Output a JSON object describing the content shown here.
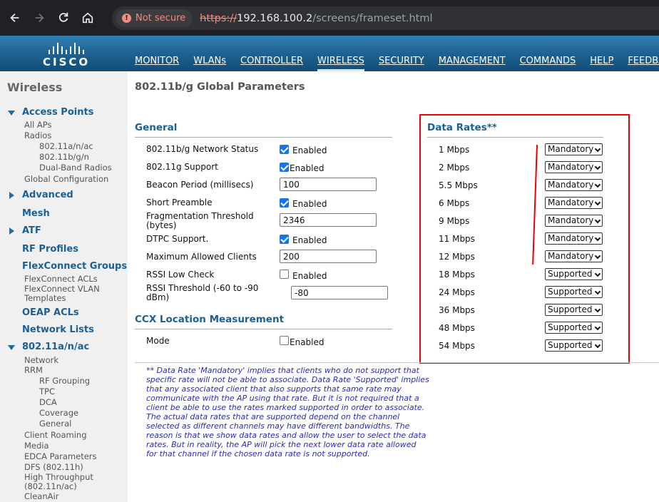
{
  "browser": {
    "security_label": "Not secure",
    "url_scheme": "https://",
    "url_host": "192.168.100.2",
    "url_path": "/screens/frameset.html"
  },
  "brand": {
    "logo_text": "CISCO"
  },
  "menu": [
    "MONITOR",
    "WLANs",
    "CONTROLLER",
    "WIRELESS",
    "SECURITY",
    "MANAGEMENT",
    "COMMANDS",
    "HELP",
    "FEEDBACK"
  ],
  "menu_active": "WIRELESS",
  "sidebar": {
    "title": "Wireless",
    "access_points": "Access Points",
    "all_aps": "All APs",
    "radios": "Radios",
    "radio_a": "802.11a/n/ac",
    "radio_b": "802.11b/g/n",
    "radio_dual": "Dual-Band Radios",
    "global_config": "Global Configuration",
    "advanced": "Advanced",
    "mesh": "Mesh",
    "atf": "ATF",
    "rf_profiles": "RF Profiles",
    "flexconnect_groups": "FlexConnect Groups",
    "flexconnect_acls": "FlexConnect ACLs",
    "flexconnect_vlan_1": "FlexConnect VLAN",
    "flexconnect_vlan_2": "Templates",
    "oeap_acls": "OEAP ACLs",
    "network_lists": "Network Lists",
    "band_a": "802.11a/n/ac",
    "network": "Network",
    "rrm": "RRM",
    "rf_grouping": "RF Grouping",
    "tpc": "TPC",
    "dca": "DCA",
    "coverage": "Coverage",
    "general": "General",
    "client_roaming": "Client Roaming",
    "media": "Media",
    "edca": "EDCA Parameters",
    "dfs": "DFS (802.11h)",
    "high_throughput_1": "High Throughput",
    "high_throughput_2": "(802.11n/ac)",
    "cleanair": "CleanAir"
  },
  "page_title": "802.11b/g Global Parameters",
  "general": {
    "heading": "General",
    "network_status_label": "802.11b/g Network Status",
    "network_status_checked": true,
    "network_status_text": "Enabled",
    "g_support_label": "802.11g Support",
    "g_support_checked": true,
    "g_support_text": "Enabled",
    "beacon_label": "Beacon Period (millisecs)",
    "beacon_value": "100",
    "short_preamble_label": "Short Preamble",
    "short_preamble_checked": true,
    "short_preamble_text": "Enabled",
    "frag_label_1": "Fragmentation Threshold",
    "frag_label_2": "(bytes)",
    "frag_value": "2346",
    "dtpc_label": "DTPC Support.",
    "dtpc_checked": true,
    "dtpc_text": "Enabled",
    "max_clients_label": "Maximum Allowed Clients",
    "max_clients_value": "200",
    "rssi_low_label": "RSSI Low Check",
    "rssi_low_checked": false,
    "rssi_low_text": "Enabled",
    "rssi_threshold_label_1": "RSSI Threshold (-60 to -90",
    "rssi_threshold_label_2": "dBm)",
    "rssi_threshold_value": "-80"
  },
  "ccx": {
    "heading": "CCX Location Measurement",
    "mode_label": "Mode",
    "mode_checked": false,
    "mode_text": "Enabled"
  },
  "data_rates": {
    "heading": "Data Rates",
    "heading_mark": "**",
    "rates": [
      {
        "rate": "1 Mbps",
        "value": "Mandatory"
      },
      {
        "rate": "2 Mbps",
        "value": "Mandatory"
      },
      {
        "rate": "5.5 Mbps",
        "value": "Mandatory"
      },
      {
        "rate": "6 Mbps",
        "value": "Mandatory"
      },
      {
        "rate": "9 Mbps",
        "value": "Mandatory"
      },
      {
        "rate": "11 Mbps",
        "value": "Mandatory"
      },
      {
        "rate": "12 Mbps",
        "value": "Mandatory"
      },
      {
        "rate": "18 Mbps",
        "value": "Supported"
      },
      {
        "rate": "24 Mbps",
        "value": "Supported"
      },
      {
        "rate": "36 Mbps",
        "value": "Supported"
      },
      {
        "rate": "48 Mbps",
        "value": "Supported"
      },
      {
        "rate": "54 Mbps",
        "value": "Supported"
      }
    ]
  },
  "footnote": [
    "** Data Rate 'Mandatory' implies that clients who do not support that",
    "specific rate will not be able to associate. Data Rate 'Supported' implies",
    "that any associated client that also supports that same rate may",
    "communicate with the AP using that rate. But it is not required that a",
    "client be able to use the rates marked supported in order to associate.",
    "The actual data rates that are supported depend on the channel",
    "selected as different channels may have different bandwidths. The",
    "reason is that we show data rates and allow the user to select the data",
    "rates. But in reality, the AP will pick the next lower data rate allowed",
    "for that channel if the chosen data rate is not supported."
  ],
  "colors": {
    "header_blue": "#1d5f8e",
    "section_blue": "#1b5f95",
    "highlight_red": "#ee0000",
    "footnote_blue": "#2a2ab8"
  }
}
